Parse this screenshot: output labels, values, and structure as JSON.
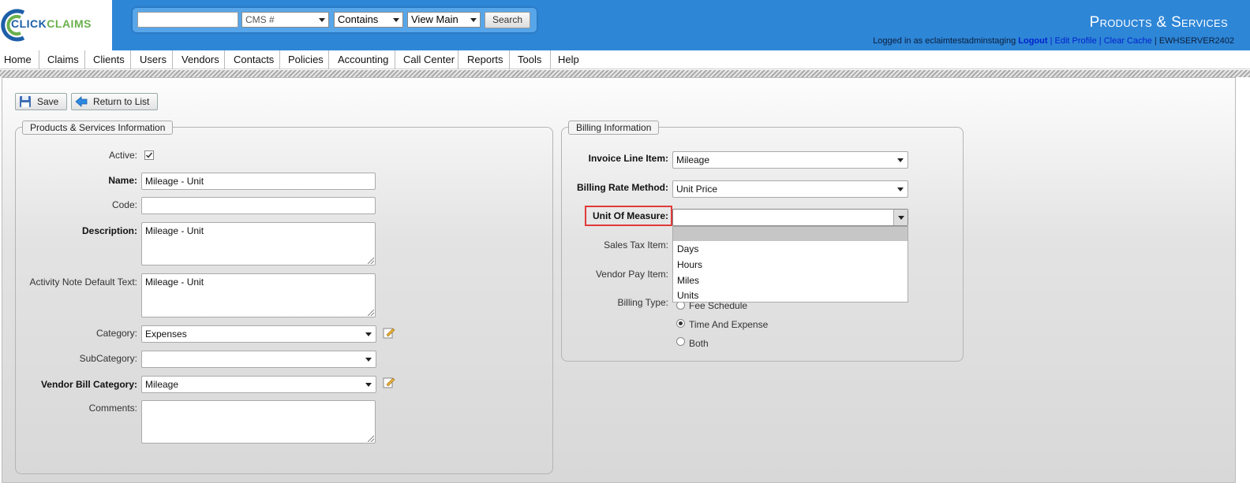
{
  "header": {
    "logo_text_a": "CLICK",
    "logo_text_b": "CLAIMS",
    "search": {
      "input_value": "",
      "field_select": "CMS #",
      "operator_select": "Contains",
      "view_select": "View Main",
      "button_label": "Search"
    },
    "page_title": "Products & Services",
    "login": {
      "prefix": "Logged in as eclaimtestadminstaging",
      "logout": "Logout",
      "sep1": "|",
      "edit_profile": "Edit Profile",
      "sep2": "|",
      "clear_cache": "Clear Cache",
      "sep3": "|",
      "server": "EWHSERVER2402"
    }
  },
  "menu": {
    "items": [
      "Home",
      "Claims",
      "Clients",
      "Users",
      "Vendors",
      "Contacts",
      "Policies",
      "Accounting",
      "Call Center",
      "Reports",
      "Tools",
      "Help"
    ]
  },
  "toolbar": {
    "save_label": "Save",
    "return_label": "Return to List"
  },
  "product_info": {
    "legend": "Products & Services Information",
    "active_label": "Active:",
    "active_checked": true,
    "name_label": "Name:",
    "name_value": "Mileage - Unit",
    "code_label": "Code:",
    "code_value": "",
    "description_label": "Description:",
    "description_value": "Mileage - Unit",
    "activity_note_label": "Activity Note Default Text:",
    "activity_note_value": "Mileage - Unit",
    "category_label": "Category:",
    "category_value": "Expenses",
    "subcategory_label": "SubCategory:",
    "subcategory_value": "",
    "vendor_bill_category_label": "Vendor Bill Category:",
    "vendor_bill_category_value": "Mileage",
    "comments_label": "Comments:",
    "comments_value": ""
  },
  "billing": {
    "legend": "Billing Information",
    "invoice_line_item_label": "Invoice Line Item:",
    "invoice_line_item_value": "Mileage",
    "billing_rate_method_label": "Billing Rate Method:",
    "billing_rate_method_value": "Unit Price",
    "unit_of_measure_label": "Unit Of Measure:",
    "unit_of_measure_value": "",
    "unit_of_measure_options": [
      "",
      "Days",
      "Hours",
      "Miles",
      "Units"
    ],
    "sales_tax_item_label": "Sales Tax Item:",
    "vendor_pay_item_label": "Vendor Pay Item:",
    "billing_type_label": "Billing Type:",
    "billing_type_options": [
      "Fee Schedule",
      "Time And Expense",
      "Both"
    ],
    "billing_type_selected": "Time And Expense"
  },
  "colors": {
    "header_blue": "#2e86d7",
    "highlight_red": "#e03a3a",
    "link_blue": "#0022cc"
  }
}
